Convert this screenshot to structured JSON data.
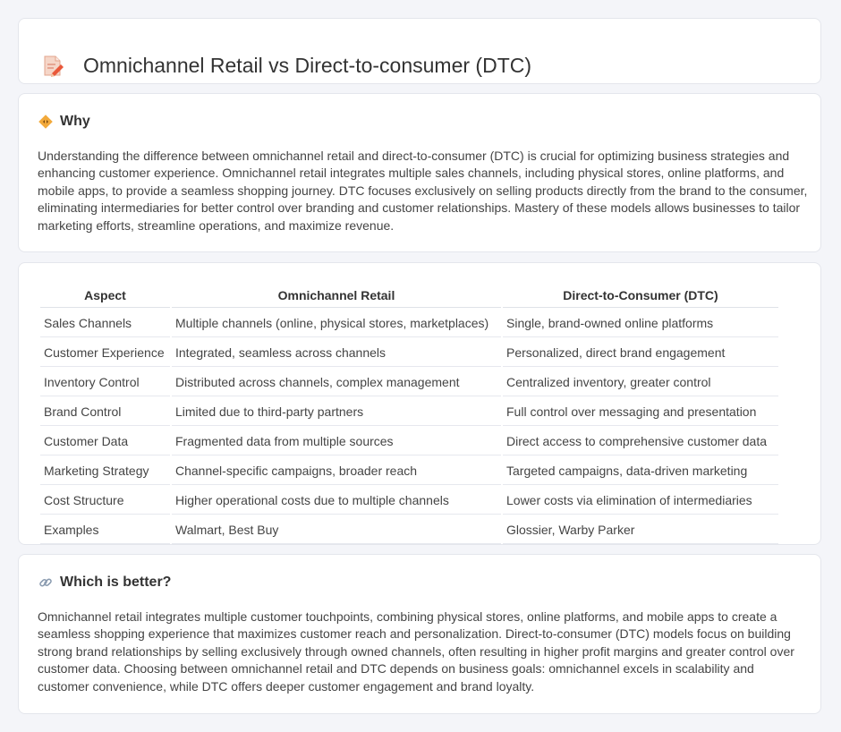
{
  "title": "Omnichannel Retail vs Direct-to-consumer (DTC)",
  "why": {
    "heading": "Why",
    "text": "Understanding the difference between omnichannel retail and direct-to-consumer (DTC) is crucial for optimizing business strategies and enhancing customer experience. Omnichannel retail integrates multiple sales channels, including physical stores, online platforms, and mobile apps, to provide a seamless shopping journey. DTC focuses exclusively on selling products directly from the brand to the consumer, eliminating intermediaries for better control over branding and customer relationships. Mastery of these models allows businesses to tailor marketing efforts, streamline operations, and maximize revenue."
  },
  "table": {
    "headers": [
      "Aspect",
      "Omnichannel Retail",
      "Direct-to-Consumer (DTC)"
    ],
    "rows": [
      [
        "Sales Channels",
        "Multiple channels (online, physical stores, marketplaces)",
        "Single, brand-owned online platforms"
      ],
      [
        "Customer Experience",
        "Integrated, seamless across channels",
        "Personalized, direct brand engagement"
      ],
      [
        "Inventory Control",
        "Distributed across channels, complex management",
        "Centralized inventory, greater control"
      ],
      [
        "Brand Control",
        "Limited due to third-party partners",
        "Full control over messaging and presentation"
      ],
      [
        "Customer Data",
        "Fragmented data from multiple sources",
        "Direct access to comprehensive customer data"
      ],
      [
        "Marketing Strategy",
        "Channel-specific campaigns, broader reach",
        "Targeted campaigns, data-driven marketing"
      ],
      [
        "Cost Structure",
        "Higher operational costs due to multiple channels",
        "Lower costs via elimination of intermediaries"
      ],
      [
        "Examples",
        "Walmart, Best Buy",
        "Glossier, Warby Parker"
      ]
    ]
  },
  "better": {
    "heading": "Which is better?",
    "text": "Omnichannel retail integrates multiple customer touchpoints, combining physical stores, online platforms, and mobile apps to create a seamless shopping experience that maximizes customer reach and personalization. Direct-to-consumer (DTC) models focus on building strong brand relationships by selling exclusively through owned channels, often resulting in higher profit margins and greater control over customer data. Choosing between omnichannel retail and DTC depends on business goals: omnichannel excels in scalability and customer convenience, while DTC offers deeper customer engagement and brand loyalty."
  },
  "icons": {
    "title": "document-pencil-icon",
    "why": "diamond-arrows-icon",
    "better": "link-icon"
  }
}
